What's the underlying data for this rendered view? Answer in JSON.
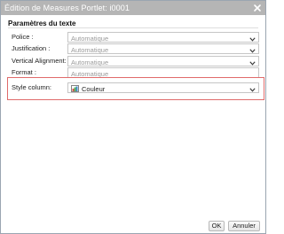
{
  "dialog": {
    "title": "Édition de Measures Portlet: i0001"
  },
  "section": {
    "title": "Paramètres du texte"
  },
  "fields": {
    "police": {
      "label": "Police :",
      "value": "Automatique"
    },
    "justification": {
      "label": "Justification :",
      "value": "Automatique"
    },
    "vertical_alignment": {
      "label": "Vertical Alignment:",
      "value": "Automatique"
    },
    "format": {
      "label": "Format :",
      "placeholder": "Automatique"
    },
    "style_column": {
      "label": "Style column:",
      "value": "Couleur"
    }
  },
  "buttons": {
    "ok": "OK",
    "cancel": "Annuler"
  },
  "icons": {
    "close": "close-icon",
    "chevron": "chevron-down-icon",
    "color_swatch": "color-swatch-icon"
  },
  "colors": {
    "titlebar": "#b5b5b5",
    "highlight": "#e06b6b",
    "placeholder_text": "#9a9a9a"
  }
}
